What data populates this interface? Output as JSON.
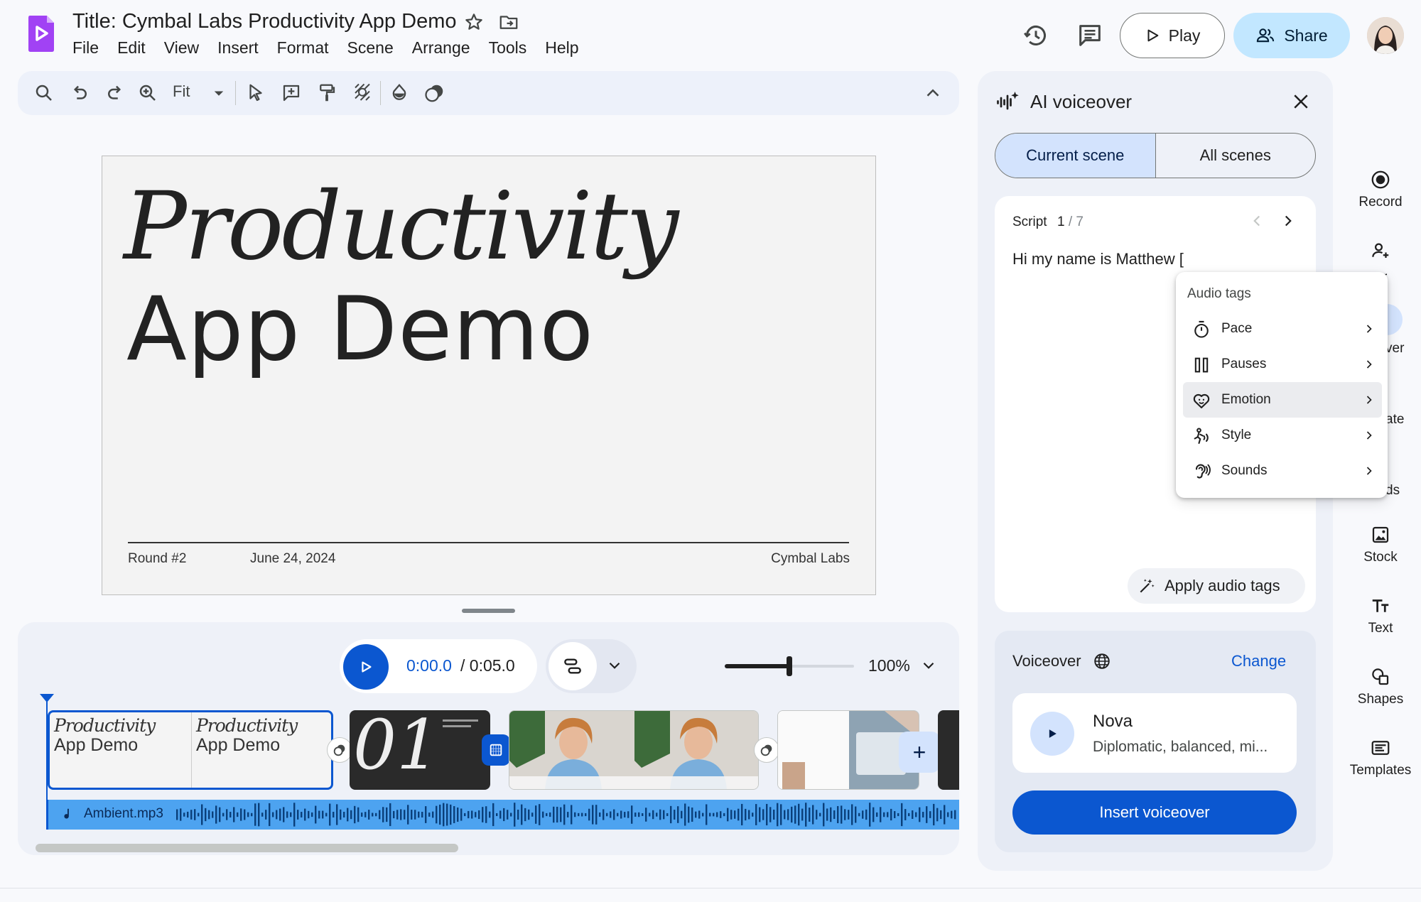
{
  "app": {
    "title": "Title: Cymbal Labs Productivity App Demo",
    "menu": [
      "File",
      "Edit",
      "View",
      "Insert",
      "Format",
      "Scene",
      "Arrange",
      "Tools",
      "Help"
    ],
    "play_label": "Play",
    "share_label": "Share"
  },
  "toolbar": {
    "zoom_value": "Fit",
    "icons": [
      "search-icon",
      "undo-icon",
      "redo-icon",
      "zoom-icon",
      "select-icon",
      "add-comment-icon",
      "paint-format-icon",
      "background-icon",
      "fill-icon",
      "mask-icon"
    ]
  },
  "slide": {
    "title_line1": "Productivity",
    "title_line2": "App Demo",
    "footer_left": "Round #2",
    "footer_date": "June 24, 2024",
    "footer_right": "Cymbal Labs"
  },
  "timeline": {
    "time_current": "0:00.0",
    "time_total": " / 0:05.0",
    "zoom_percent": "100%",
    "zoom_level": 0.5,
    "clip1_title_line1": "Productivity",
    "clip1_title_line2": "App Demo",
    "clip2_number": "01",
    "audio_file": "Ambient.mp3"
  },
  "panel": {
    "title": "AI voiceover",
    "tabs": {
      "current": "Current scene",
      "all": "All scenes"
    },
    "script_label": "Script",
    "script_index": "1",
    "script_total": " / 7",
    "script_text": "Hi my name is Matthew [",
    "audio_tags_header": "Audio tags",
    "audio_tags": [
      {
        "label": "Pace",
        "icon": "timer-icon"
      },
      {
        "label": "Pauses",
        "icon": "pause-icon"
      },
      {
        "label": "Emotion",
        "icon": "emotion-heart-icon"
      },
      {
        "label": "Style",
        "icon": "style-icon"
      },
      {
        "label": "Sounds",
        "icon": "sounds-icon"
      }
    ],
    "apply_label": "Apply audio tags",
    "voiceover_label": "Voiceover",
    "change_label": "Change",
    "voice_name": "Nova",
    "voice_desc": "Diplomatic, balanced, mi...",
    "insert_label": "Insert voiceover"
  },
  "rail": {
    "record": "Record",
    "avatar_partial": "r",
    "voiceover_partial": "ver",
    "translate_partial": "ate",
    "sounds_partial": "ds",
    "stock": "Stock",
    "text": "Text",
    "shapes": "Shapes",
    "templates": "Templates"
  },
  "colors": {
    "accent": "#0b57d0",
    "accent_light": "#d3e3fd",
    "share_bg": "#c2e7ff",
    "logo": "#a142f4",
    "audio_track": "#4da3f0"
  }
}
